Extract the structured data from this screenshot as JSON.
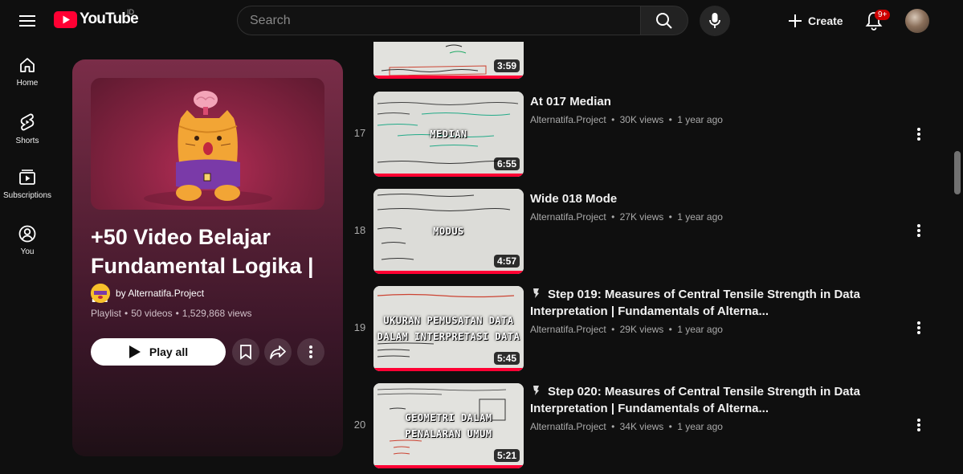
{
  "header": {
    "logo_text": "YouTube",
    "country": "ID",
    "search_placeholder": "Search",
    "create_label": "Create",
    "notifications_badge": "9+"
  },
  "sidebar": {
    "items": [
      {
        "label": "Home",
        "icon": "home-icon"
      },
      {
        "label": "Shorts",
        "icon": "shorts-icon"
      },
      {
        "label": "Subscriptions",
        "icon": "subscriptions-icon"
      },
      {
        "label": "You",
        "icon": "you-icon"
      }
    ]
  },
  "playlist": {
    "title": "+50 Video Belajar Fundamental Logika | ...",
    "owner": "by Alternatifa.Project",
    "type": "Playlist",
    "video_count": "50 videos",
    "views": "1,529,868 views",
    "play_all_label": "Play all"
  },
  "videos": [
    {
      "index": "",
      "title": "",
      "channel": "",
      "views": "",
      "age": "",
      "duration": "3:59",
      "overlay": [
        "",
        ""
      ]
    },
    {
      "index": "17",
      "title": "At 017 Median",
      "channel": "Alternatifa.Project",
      "views": "30K views",
      "age": "1 year ago",
      "duration": "6:55",
      "overlay": [
        "MEDIAN",
        ""
      ]
    },
    {
      "index": "18",
      "title": "Wide 018 Mode",
      "channel": "Alternatifa.Project",
      "views": "27K views",
      "age": "1 year ago",
      "duration": "4:57",
      "overlay": [
        "MODUS",
        ""
      ]
    },
    {
      "index": "19",
      "title": "Step 019: Measures of Central Tensile Strength in Data Interpretation | Fundamentals of Alterna...",
      "channel": "Alternatifa.Project",
      "views": "29K views",
      "age": "1 year ago",
      "duration": "5:45",
      "overlay": [
        "UKURAN PEMUSATAN DATA",
        "DALAM INTERPRETASI DATA"
      ]
    },
    {
      "index": "20",
      "title": "Step 020: Measures of Central Tensile Strength in Data Interpretation | Fundamentals of Alterna...",
      "channel": "Alternatifa.Project",
      "views": "34K views",
      "age": "1 year ago",
      "duration": "5:21",
      "overlay": [
        "GEOMETRI DALAM",
        "PENALARAN UMUM"
      ]
    }
  ],
  "separator": "•",
  "colors": {
    "accent": "#ff0033",
    "badge": "#cc0000",
    "playlist_bg": "#7a2d48"
  }
}
